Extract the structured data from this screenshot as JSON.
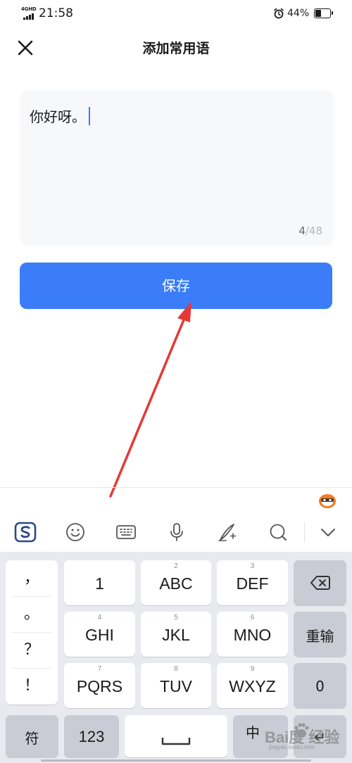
{
  "status": {
    "network": "4GHD",
    "time": "21:58",
    "battery_percent": "44%",
    "battery_level": 0.44
  },
  "header": {
    "title": "添加常用语",
    "close_icon": "close-icon"
  },
  "editor": {
    "text": "你好呀。",
    "count_current": "4",
    "count_max": "/48"
  },
  "save_button": {
    "label": "保存"
  },
  "colors": {
    "accent": "#3b7df8",
    "arrow": "#e53935",
    "keyboard_bg": "#e8eaf0"
  },
  "keyboard": {
    "toolbar": [
      "sogou-logo-icon",
      "emoji-icon",
      "keyboard-icon",
      "microphone-icon",
      "handwriting-icon",
      "search-icon",
      "chevron-down-icon"
    ],
    "punctuation": [
      "，",
      "。",
      "？",
      "！"
    ],
    "keys": {
      "k1": {
        "num": "",
        "label": "1"
      },
      "k2": {
        "num": "2",
        "label": "ABC"
      },
      "k3": {
        "num": "3",
        "label": "DEF"
      },
      "k4": {
        "num": "4",
        "label": "GHI"
      },
      "k5": {
        "num": "5",
        "label": "JKL"
      },
      "k6": {
        "num": "6",
        "label": "MNO"
      },
      "k7": {
        "num": "7",
        "label": "PQRS"
      },
      "k8": {
        "num": "8",
        "label": "TUV"
      },
      "k9": {
        "num": "9",
        "label": "WXYZ"
      }
    },
    "reinput": "重输",
    "zero": "0",
    "symbol": "符",
    "numeric": "123",
    "cn_en": "中",
    "enter": "↵"
  },
  "watermark": {
    "brand": "Bai度 经验",
    "url": "jingyan.baidu.com"
  }
}
